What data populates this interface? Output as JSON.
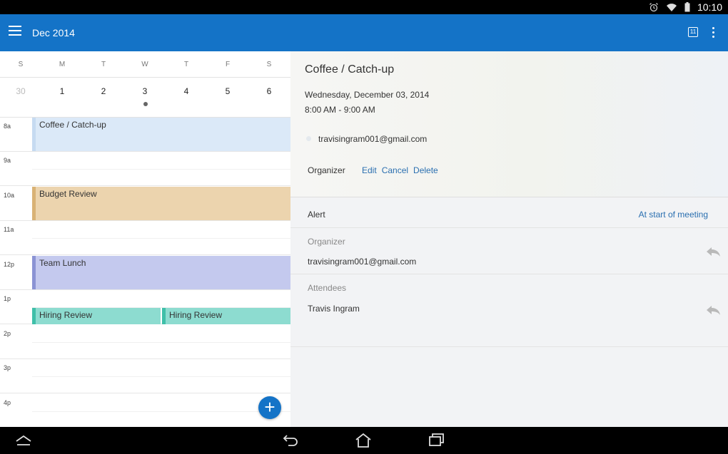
{
  "status_bar": {
    "time": "10:10",
    "icons": [
      "alarm-icon",
      "wifi-icon",
      "battery-icon"
    ]
  },
  "app_bar": {
    "title": "Dec 2014",
    "today_badge": "11",
    "accent": "#1473c7"
  },
  "week": {
    "days": [
      {
        "dow": "S",
        "date": "30",
        "other_month": true
      },
      {
        "dow": "M",
        "date": "1"
      },
      {
        "dow": "T",
        "date": "2"
      },
      {
        "dow": "W",
        "date": "3",
        "has_events": true
      },
      {
        "dow": "T",
        "date": "4"
      },
      {
        "dow": "F",
        "date": "5"
      },
      {
        "dow": "S",
        "date": "6"
      }
    ]
  },
  "timeline": {
    "hours": [
      "8a",
      "9a",
      "10a",
      "11a",
      "12p",
      "1p",
      "2p",
      "3p",
      "4p"
    ],
    "events": {
      "coffee": "Coffee / Catch-up",
      "budget": "Budget Review",
      "lunch": "Team Lunch",
      "hiring_1": "Hiring Review",
      "hiring_2": "Hiring Review"
    }
  },
  "detail": {
    "title": "Coffee / Catch-up",
    "date": "Wednesday, December 03, 2014",
    "time": "8:00 AM - 9:00 AM",
    "attendee_email": "travisingram001@gmail.com",
    "role": "Organizer",
    "actions": {
      "edit": "Edit",
      "cancel": "Cancel",
      "delete": "Delete"
    },
    "alert_label": "Alert",
    "alert_value": "At start of meeting",
    "organizer_label": "Organizer",
    "organizer_value": "travisingram001@gmail.com",
    "attendees_label": "Attendees",
    "attendees_value": "Travis Ingram"
  },
  "nav_bar": {
    "buttons": [
      "collapse-icon",
      "back-icon",
      "home-icon",
      "recents-icon"
    ]
  }
}
